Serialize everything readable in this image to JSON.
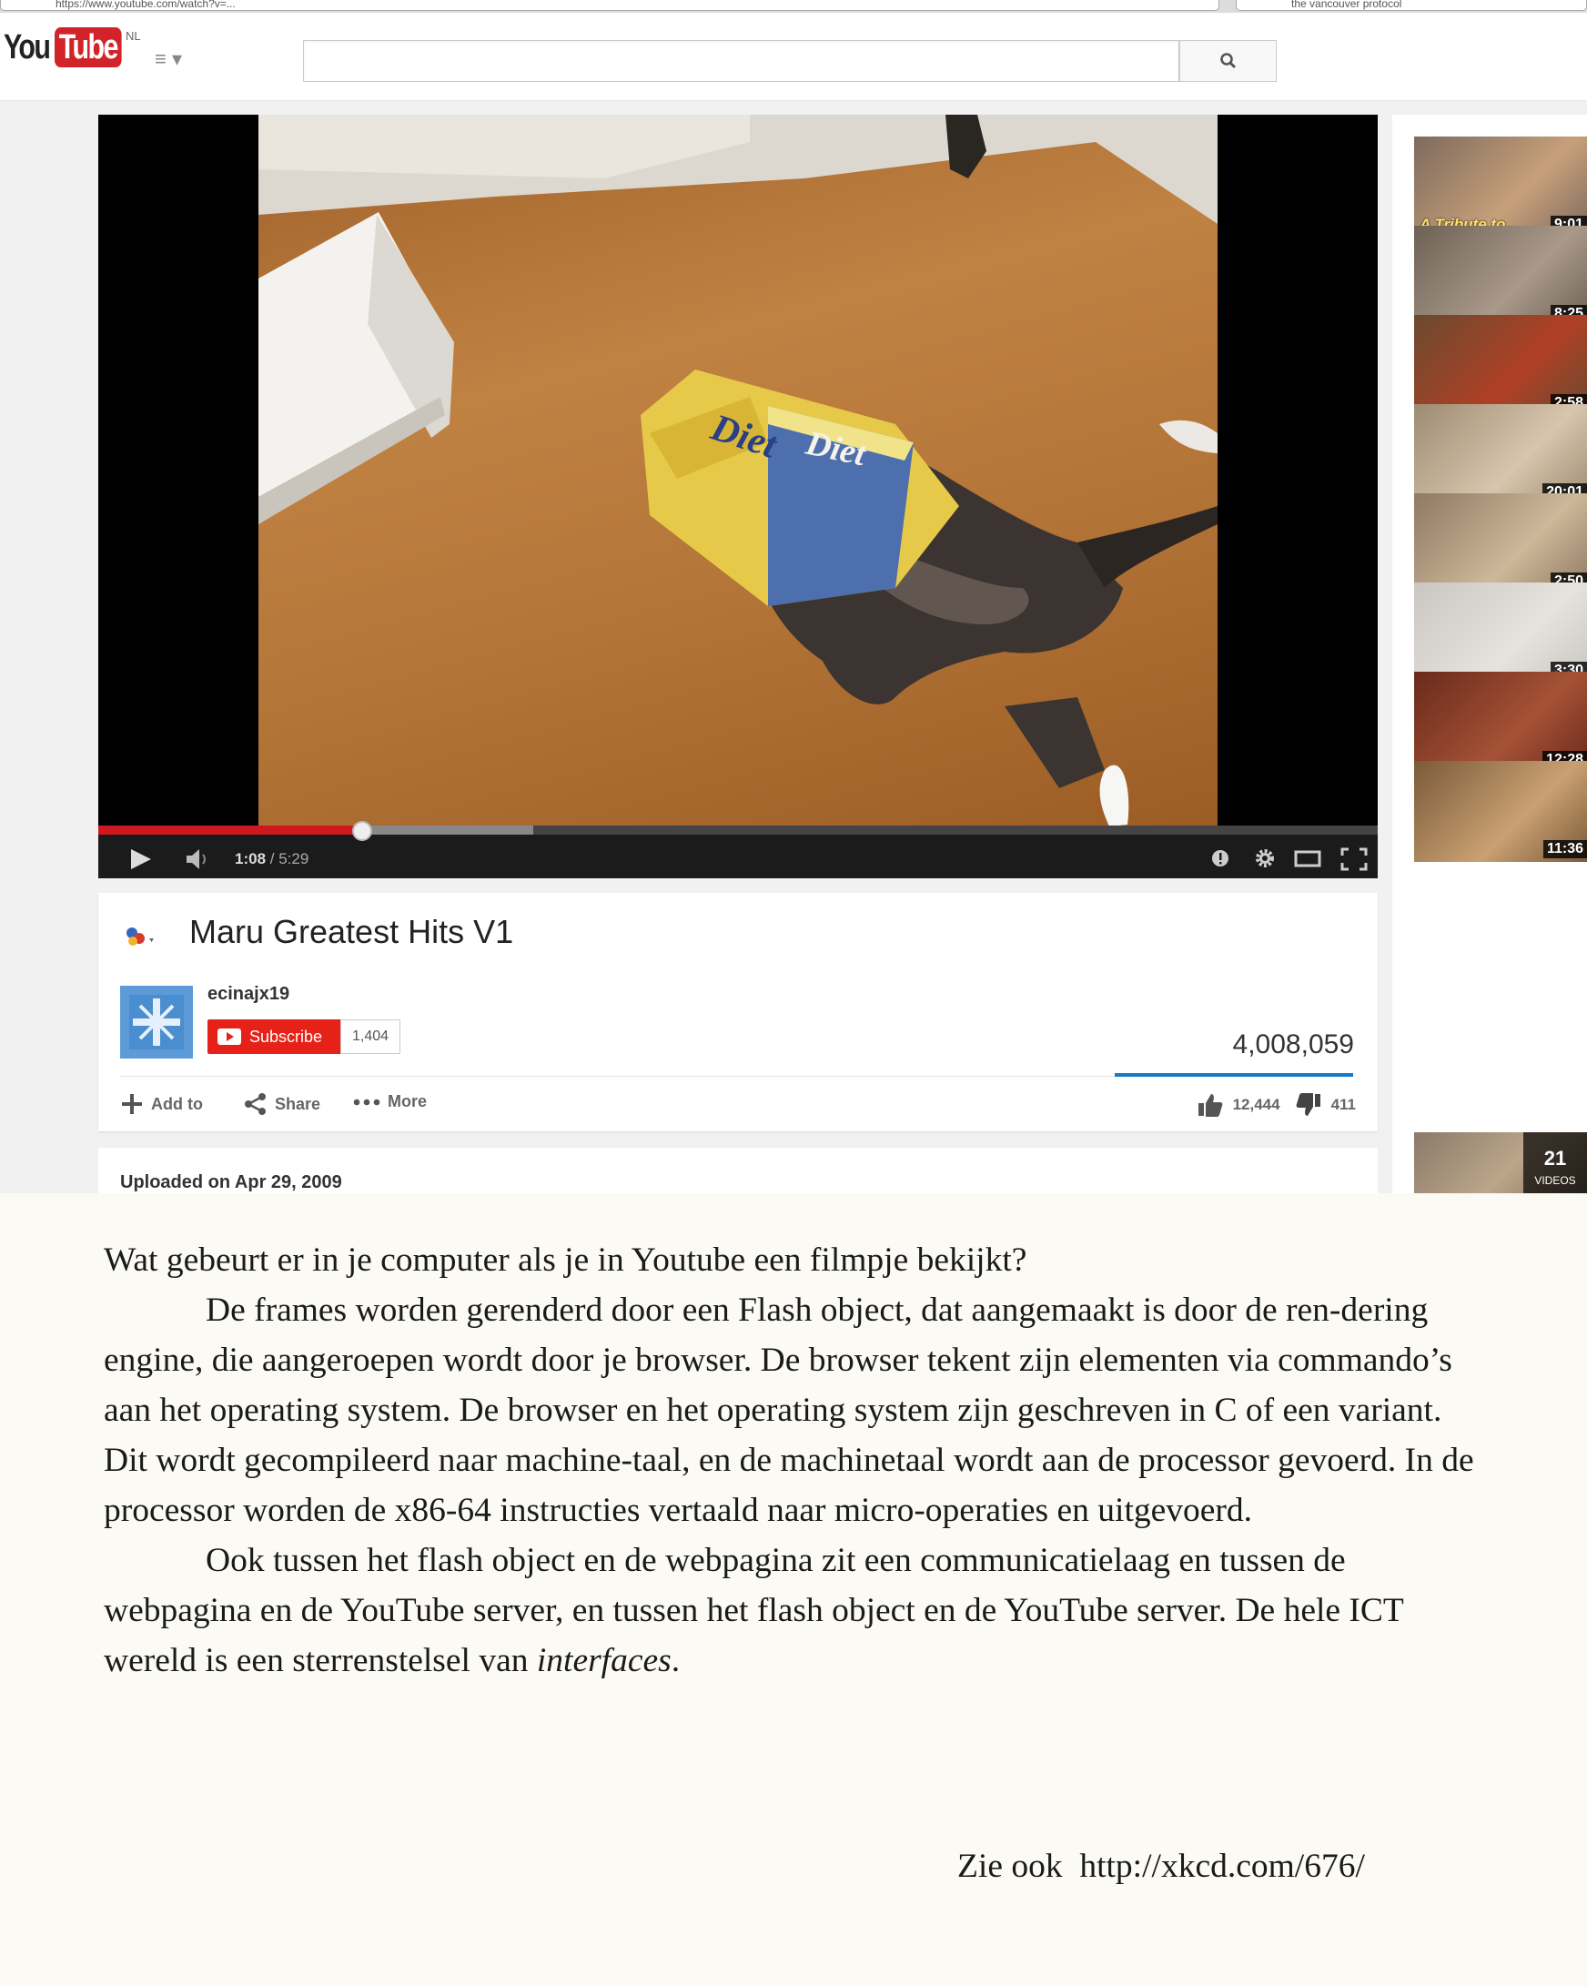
{
  "browser": {
    "url_partial": "https://www.youtube.com/watch?v=...",
    "second_tab_partial": "the vancouver protocol"
  },
  "header": {
    "logo_you": "You",
    "logo_tube": "Tube",
    "region": "NL",
    "guide_label": "≡ ▾",
    "search_value": ""
  },
  "player": {
    "time_current": "1:08",
    "time_sep": " / ",
    "time_duration": "5:29",
    "progress_fraction": 0.206,
    "buffered_fraction": 0.34,
    "box_text": "Diet"
  },
  "video": {
    "title": "Maru Greatest Hits V1",
    "channel": "ecinajx19",
    "subscribe_label": "Subscribe",
    "subscriber_count": "1,404",
    "views": "4,008,059",
    "actions": {
      "add_to": "Add to",
      "share": "Share",
      "more": "More"
    },
    "likes": "12,444",
    "dislikes": "411",
    "uploaded": "Uploaded on Apr 29, 2009"
  },
  "sidebar": {
    "thumbnails": [
      {
        "duration": "9:01",
        "overlay_text": "A Tribute to",
        "colors": [
          "#7d6a5e",
          "#c7a07a"
        ]
      },
      {
        "duration": "8:25",
        "colors": [
          "#6d6154",
          "#a9998a"
        ]
      },
      {
        "duration": "2:58",
        "colors": [
          "#6a4a30",
          "#b04025"
        ]
      },
      {
        "duration": "20:01",
        "colors": [
          "#9d8a72",
          "#d7c6ad"
        ]
      },
      {
        "duration": "2:50",
        "colors": [
          "#8f7a62",
          "#cdb89a"
        ]
      },
      {
        "duration": "3:30",
        "colors": [
          "#c9c6c2",
          "#e6e3de"
        ]
      },
      {
        "duration": "12:28",
        "colors": [
          "#6a2a1a",
          "#a55237"
        ]
      },
      {
        "duration": "11:36",
        "colors": [
          "#7a5a3a",
          "#c9a071"
        ]
      }
    ],
    "playlist": {
      "count": "21",
      "label": "VIDEOS"
    }
  },
  "article": {
    "question": "Wat gebeurt er in je computer als je in Youtube een filmpje bekijkt?",
    "para1": "De frames worden gerenderd door een Flash object, dat aangemaakt is door de ren-dering engine, die aangeroepen wordt door je browser. De browser tekent zijn elementen via commando’s aan het operating system. De browser en het operating system zijn geschreven in C of een variant. Dit wordt gecompileerd naar machine-taal, en de machinetaal wordt aan de processor gevoerd. In de processor worden de x86-64 instructies vertaald naar micro-operaties en uitgevoerd.",
    "para2_main": "Ook tussen het flash object en de webpagina zit een communicatielaag en tussen de webpagina en de YouTube server, en tussen het flash object en de YouTube server. De hele ICT wereld is een sterrenstelsel van ",
    "para2_emph": "interfaces",
    "para2_end": ".",
    "see_also": "Zie ook  http://xkcd.com/676/"
  },
  "colors": {
    "youtube_red": "#cc181e",
    "subscribe_red": "#e62117",
    "views_bar_blue": "#167ac6",
    "page_background": "#fbfaf4"
  },
  "icons": [
    "search-icon",
    "play-icon",
    "volume-icon",
    "annotations-icon",
    "settings-gear-icon",
    "theater-mode-icon",
    "fullscreen-icon",
    "add-icon",
    "share-icon",
    "more-dots-icon",
    "thumbs-up-icon",
    "thumbs-down-icon",
    "youtube-play-icon"
  ]
}
